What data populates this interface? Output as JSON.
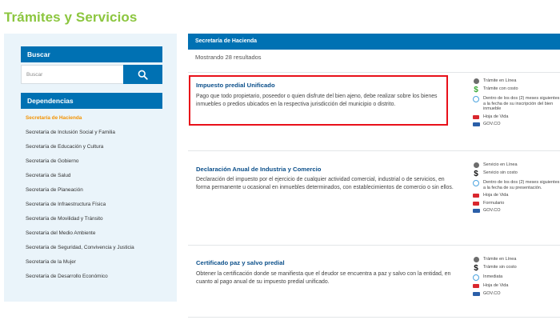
{
  "page": {
    "title": "Trámites y Servicios"
  },
  "sidebar": {
    "search_header": "Buscar",
    "search_placeholder": "Buscar",
    "dependencies_header": "Dependencias",
    "items": [
      {
        "label": "Secretaría de Hacienda",
        "active": true
      },
      {
        "label": "Secretaría de Inclusión Social y Familia"
      },
      {
        "label": "Secretaría de Educación y Cultura"
      },
      {
        "label": "Secretaría de Gobierno"
      },
      {
        "label": "Secretaría de Salud"
      },
      {
        "label": "Secretaría de Planeación"
      },
      {
        "label": "Secretaría de Infraestructura Física"
      },
      {
        "label": "Secretaría de Movilidad y Tránsito"
      },
      {
        "label": "Secretaría del Medio Ambiente"
      },
      {
        "label": "Secretaría de Seguridad, Convivencia y Justicia"
      },
      {
        "label": "Secretaría de la Mujer"
      },
      {
        "label": "Secretaría de Desarrollo Económico"
      }
    ]
  },
  "main": {
    "header": "Secretaría de Hacienda",
    "result_count": "Mostrando 28 resultados",
    "cards": [
      {
        "title": "Impuesto predial Unificado",
        "description": "Pago que todo propietario, poseedor o quien disfrute del bien ajeno, debe realizar sobre los bienes inmuebles o predios ubicados en la respectiva jurisdicción del municipio o distrito.",
        "meta": [
          {
            "icon": "globe-icon",
            "text": "Trámite en Línea"
          },
          {
            "icon": "dollar-icon",
            "text": "Trámite con costo"
          },
          {
            "icon": "clock-icon",
            "text": "Dentro de los dos (2) meses siguientes a la fecha de su inscripción del bien inmueble"
          },
          {
            "icon": "pdf-icon",
            "text": "Hoja de Vida"
          },
          {
            "icon": "gov-co-icon",
            "text": "GOV.CO"
          }
        ]
      },
      {
        "title": "Declaración Anual de Industria y Comercio",
        "description": "Declaración del impuesto por el ejercicio de cualquier actividad comercial, industrial o de servicios, en forma permanente u ocasional en inmuebles determinados, con establecimientos de comercio o sin ellos.",
        "meta": [
          {
            "icon": "globe-icon",
            "text": "Servicio en Línea"
          },
          {
            "icon": "dollar-icon",
            "text": "Servicio sin costo"
          },
          {
            "icon": "clock-icon",
            "text": "Dentro de los dos (2) meses siguientes a la fecha de su presentación."
          },
          {
            "icon": "pdf-icon",
            "text": "Hoja de Vida"
          },
          {
            "icon": "pdf-icon",
            "text": "Formulario"
          },
          {
            "icon": "gov-co-icon",
            "text": "GOV.CO"
          }
        ]
      },
      {
        "title": "Certificado paz y salvo predial",
        "description": "Obtener la certificación donde se manifiesta que el deudor se encuentra a paz y salvo con la entidad, en cuanto al pago anual de su impuesto predial unificado.",
        "meta": [
          {
            "icon": "globe-icon",
            "text": "Trámite en Línea"
          },
          {
            "icon": "dollar-icon",
            "text": "Trámite sin costo"
          },
          {
            "icon": "clock-icon",
            "text": "Inmediata"
          },
          {
            "icon": "pdf-icon",
            "text": "Hoja de Vida"
          },
          {
            "icon": "gov-co-icon",
            "text": "GOV.CO"
          }
        ]
      }
    ]
  },
  "colors": {
    "brand_green": "#8cc63f",
    "brand_blue": "#0071b3",
    "active_orange": "#f39200",
    "highlight_red": "#e8101a"
  }
}
